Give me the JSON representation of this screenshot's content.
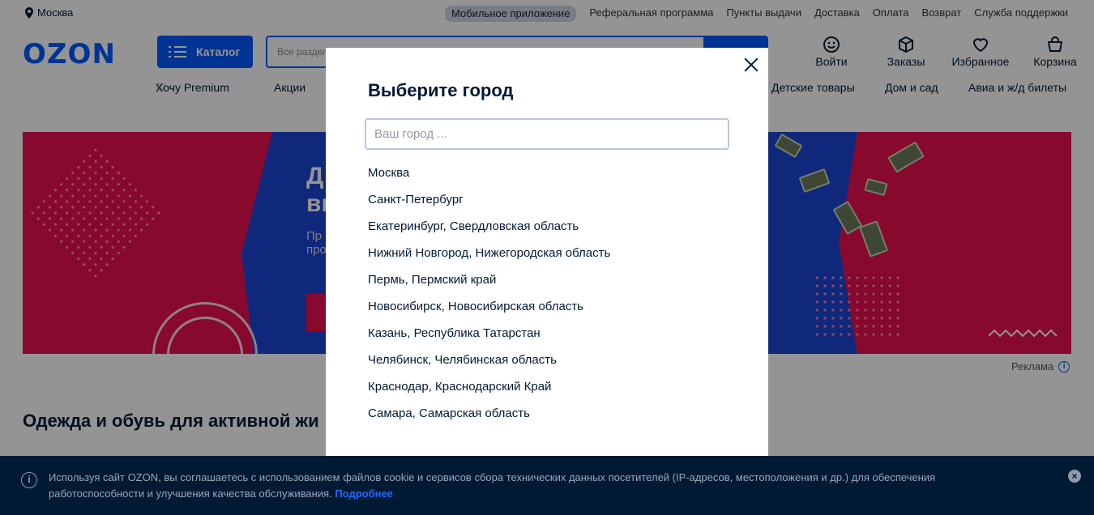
{
  "topbar": {
    "location": "Москва",
    "links": [
      "Мобильное приложение",
      "Реферальная программа",
      "Пункты выдачи",
      "Доставка",
      "Оплата",
      "Возврат",
      "Служба поддержки"
    ]
  },
  "header": {
    "logo": "OZON",
    "catalog_label": "Каталог",
    "search_placeholder": "Все разделы",
    "icons": [
      {
        "icon": "smile-icon",
        "label": "Войти"
      },
      {
        "icon": "box-icon",
        "label": "Заказы"
      },
      {
        "icon": "heart-icon",
        "label": "Избранное"
      },
      {
        "icon": "bag-icon",
        "label": "Корзина"
      }
    ]
  },
  "nav": {
    "items": [
      "Хочу Premium",
      "Акции",
      "Детские товары",
      "Дом и сад",
      "Авиа и ж/д билеты"
    ]
  },
  "banner": {
    "title_line1": "Д",
    "title_line2": "ви",
    "sub_line1": "Пр",
    "sub_line2": "про"
  },
  "ad_label": "Реклама",
  "section_title": "Одежда и обувь для активной жи",
  "modal": {
    "title": "Выберите город",
    "input_placeholder": "Ваш город ...",
    "cities": [
      "Москва",
      "Санкт-Петербург",
      "Екатеринбург, Свердловская область",
      "Нижний Новгород, Нижегородская область",
      "Пермь, Пермский край",
      "Новосибирск, Новосибирская область",
      "Казань, Республика Татарстан",
      "Челябинск, Челябинская область",
      "Краснодар, Краснодарский Край",
      "Самара, Самарская область"
    ]
  },
  "cookie": {
    "text": "Используя сайт OZON, вы соглашаетесь с использованием файлов cookie и сервисов сбора технических данных посетителей (IP-адресов, местоположения и др.) для обеспечения работоспособности и улучшения качества обслуживания.",
    "more": "Подробнее"
  },
  "colors": {
    "brand": "#005bff",
    "banner_red": "#e8104f",
    "banner_blue": "#1d45d6",
    "cookie_bg": "#001a34"
  }
}
